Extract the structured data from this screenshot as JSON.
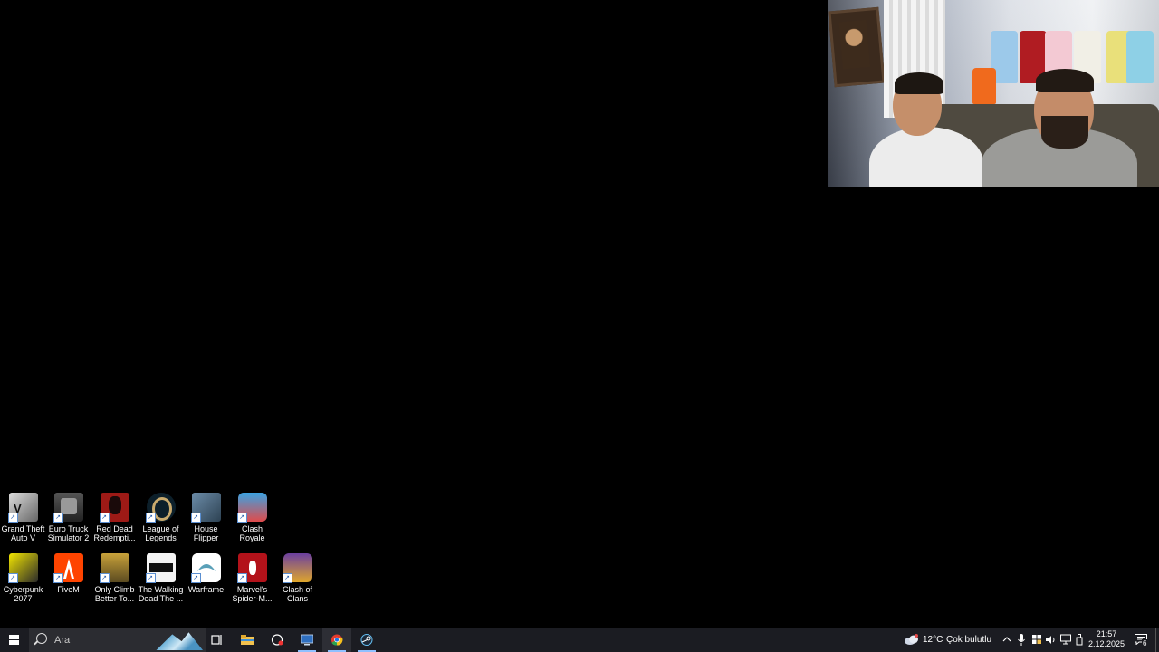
{
  "desktop": {
    "icons_row1": [
      {
        "label": "Grand Theft Auto V",
        "icon": "gta-v-icon"
      },
      {
        "label": "Euro Truck Simulator 2",
        "icon": "euro-truck-icon"
      },
      {
        "label": "Red Dead Redempti...",
        "icon": "red-dead-icon"
      },
      {
        "label": "League of Legends",
        "icon": "league-of-legends-icon"
      },
      {
        "label": "House Flipper",
        "icon": "house-flipper-icon"
      },
      {
        "label": "Clash Royale",
        "icon": "clash-royale-icon"
      }
    ],
    "icons_row2": [
      {
        "label": "Cyberpunk 2077",
        "icon": "cyberpunk-icon"
      },
      {
        "label": "FiveM",
        "icon": "fivem-icon"
      },
      {
        "label": "Only Climb Better To...",
        "icon": "only-climb-icon"
      },
      {
        "label": "The Walking Dead The ...",
        "icon": "walking-dead-icon"
      },
      {
        "label": "Warframe",
        "icon": "warframe-icon"
      },
      {
        "label": "Marvel's Spider-M...",
        "icon": "spider-man-icon"
      },
      {
        "label": "Clash of Clans",
        "icon": "clash-of-clans-icon"
      }
    ]
  },
  "taskbar": {
    "search_placeholder": "Ara",
    "pinned": [
      "task-view-icon",
      "file-explorer-icon",
      "screen-recorder-icon",
      "remote-desktop-icon",
      "chrome-icon",
      "steam-icon"
    ],
    "weather": {
      "temp": "12°C",
      "condition": "Çok bulutlu"
    },
    "clock": {
      "time": "21:57",
      "date": "2.12.2025"
    },
    "notification_count": "6"
  },
  "colors": {
    "taskbar": "#1b1c22",
    "desktop": "#000000",
    "active_indicator": "#8fc0ff"
  }
}
